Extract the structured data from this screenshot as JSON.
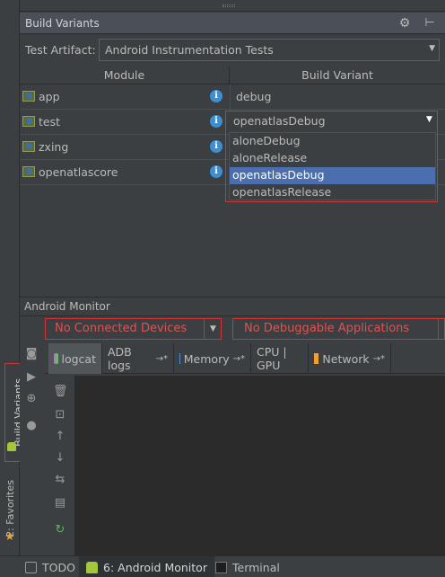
{
  "build_variants": {
    "title": "Build Variants",
    "test_artifact_label": "Test Artifact:",
    "test_artifact_value": "Android Instrumentation Tests",
    "columns": {
      "module": "Module",
      "variant": "Build Variant"
    },
    "rows": [
      {
        "module": "app",
        "variant": "debug"
      },
      {
        "module": "test",
        "variant": "openatlasDebug"
      },
      {
        "module": "zxing",
        "variant": ""
      },
      {
        "module": "openatlascore",
        "variant": ""
      }
    ],
    "dropdown": {
      "current": "openatlasDebug",
      "options": [
        "aloneDebug",
        "aloneRelease",
        "openatlasDebug",
        "openatlasRelease"
      ],
      "selected_index": 2
    }
  },
  "android_monitor": {
    "title": "Android Monitor",
    "device_select": "No Connected Devices",
    "app_select": "No Debuggable Applications",
    "tabs": [
      {
        "label": "logcat"
      },
      {
        "label": "ADB logs",
        "suffix": "→*"
      },
      {
        "label": "Memory",
        "suffix": "→*"
      },
      {
        "label": "CPU | GPU"
      },
      {
        "label": "Network",
        "suffix": "→*"
      }
    ]
  },
  "side_tabs": {
    "build_variants": "Build Variants",
    "favorites": "2: Favorites"
  },
  "bottom_tabs": [
    {
      "label": "TODO"
    },
    {
      "label": "6: Android Monitor"
    },
    {
      "label": "Terminal"
    }
  ],
  "colors": {
    "highlight_border": "#d03434",
    "selection": "#4b6eaf",
    "error_text": "#e05151"
  }
}
